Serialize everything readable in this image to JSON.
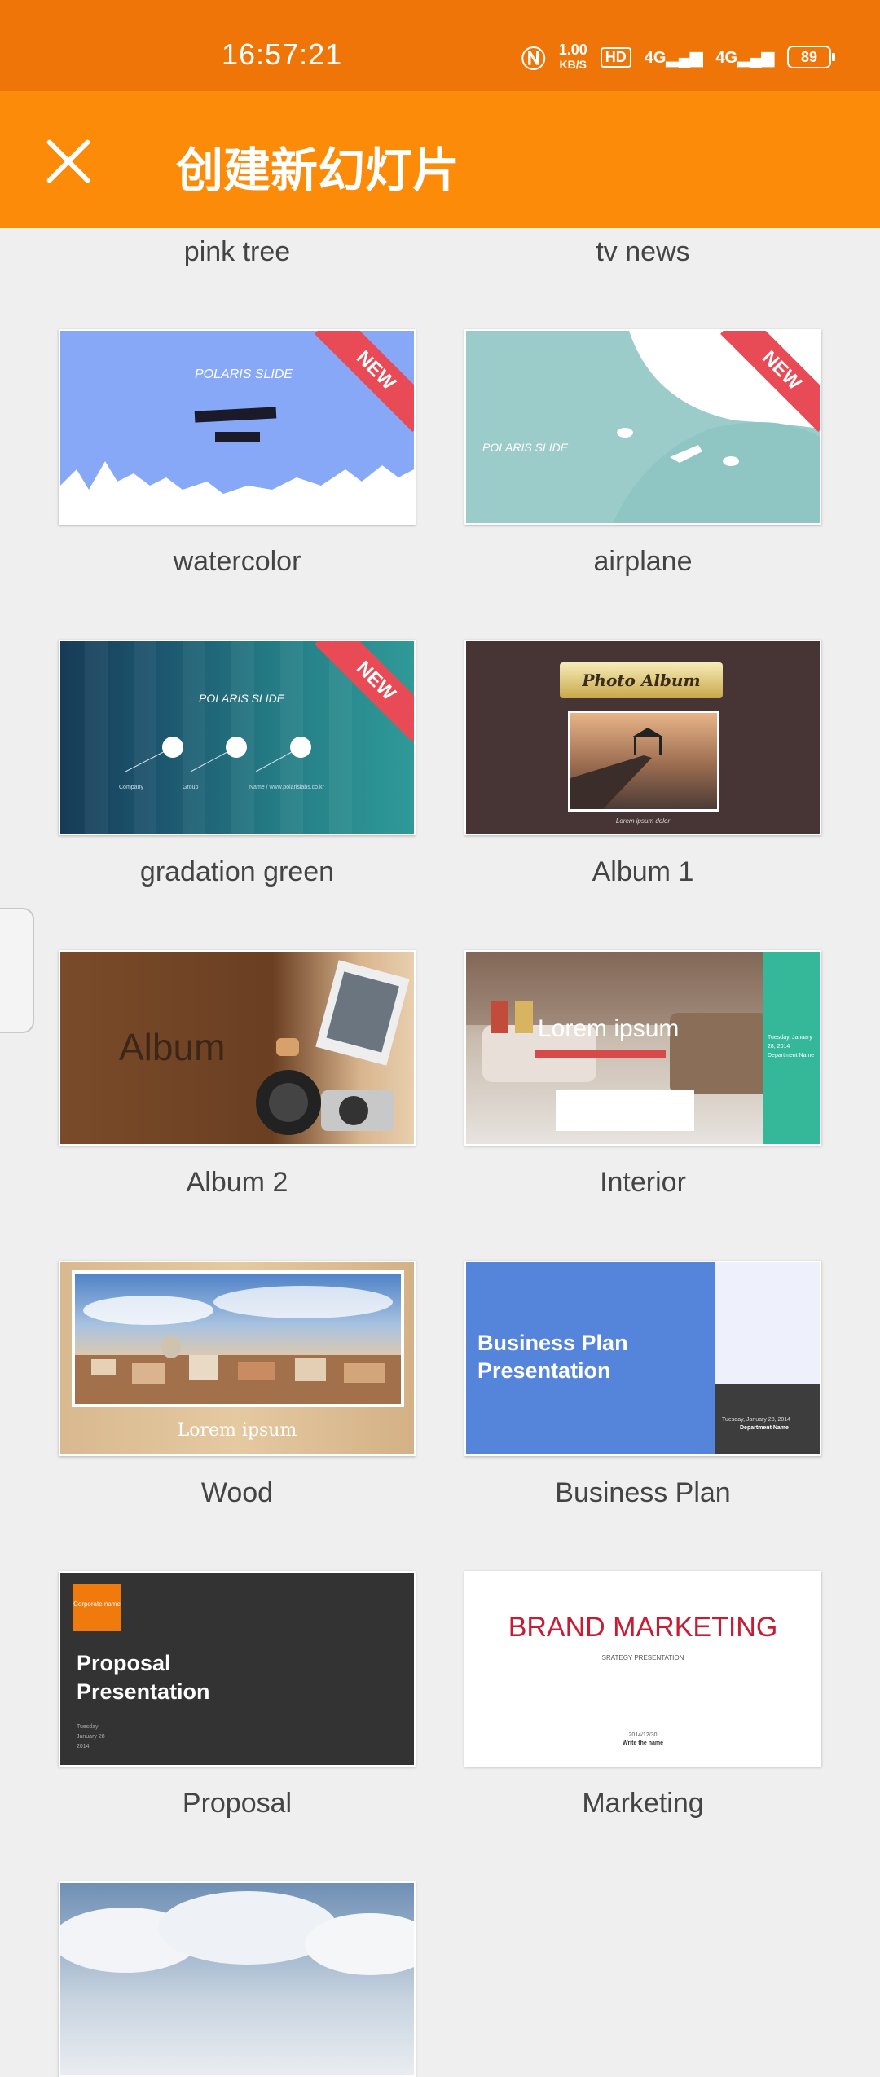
{
  "status_bar": {
    "time": "16:57:21",
    "net_speed": "1.00",
    "net_unit": "KB/S",
    "hd": "HD",
    "sig1": "4G",
    "sig2": "4G",
    "battery": "89"
  },
  "app_bar": {
    "title": "创建新幻灯片"
  },
  "top_labels": [
    "pink tree",
    "tv news"
  ],
  "templates": [
    {
      "name": "watercolor",
      "thumb_title": "POLARIS SLIDE",
      "badge": "NEW"
    },
    {
      "name": "airplane",
      "thumb_title": "POLARIS SLIDE",
      "badge": "NEW"
    },
    {
      "name": "gradation green",
      "thumb_title": "POLARIS SLIDE",
      "badge": "NEW",
      "sub_labels": [
        "Company",
        "Group",
        "Name / www.polarislabs.co.kr"
      ]
    },
    {
      "name": "Album 1",
      "thumb_title": "Photo Album",
      "caption": "Lorem ipsum dolor"
    },
    {
      "name": "Album 2",
      "thumb_title": "Album"
    },
    {
      "name": "Interior",
      "thumb_title": "Lorem ipsum",
      "side_text": "Tuesday, January 28, 2014 Department Name"
    },
    {
      "name": "Wood",
      "thumb_title": "Lorem ipsum"
    },
    {
      "name": "Business Plan",
      "thumb_title": "Business Plan Presentation",
      "date_text": "Tuesday, January 28, 2014",
      "dept_text": "Department Name"
    },
    {
      "name": "Proposal",
      "thumb_title": "Proposal Presentation",
      "badge_text": "Corporate name",
      "date_lines": [
        "Tuesday",
        "January 28",
        "2014"
      ]
    },
    {
      "name": "Marketing",
      "thumb_title": "BRAND MARKETING",
      "subtitle": "SRATEGY PRESENTATION",
      "date_text": "2014/12/30",
      "write_text": "Write the name"
    }
  ],
  "colors": {
    "status_bar": "#f07508",
    "app_bar": "#fb8b09",
    "background": "#efefef",
    "ribbon": "#e84b55"
  }
}
